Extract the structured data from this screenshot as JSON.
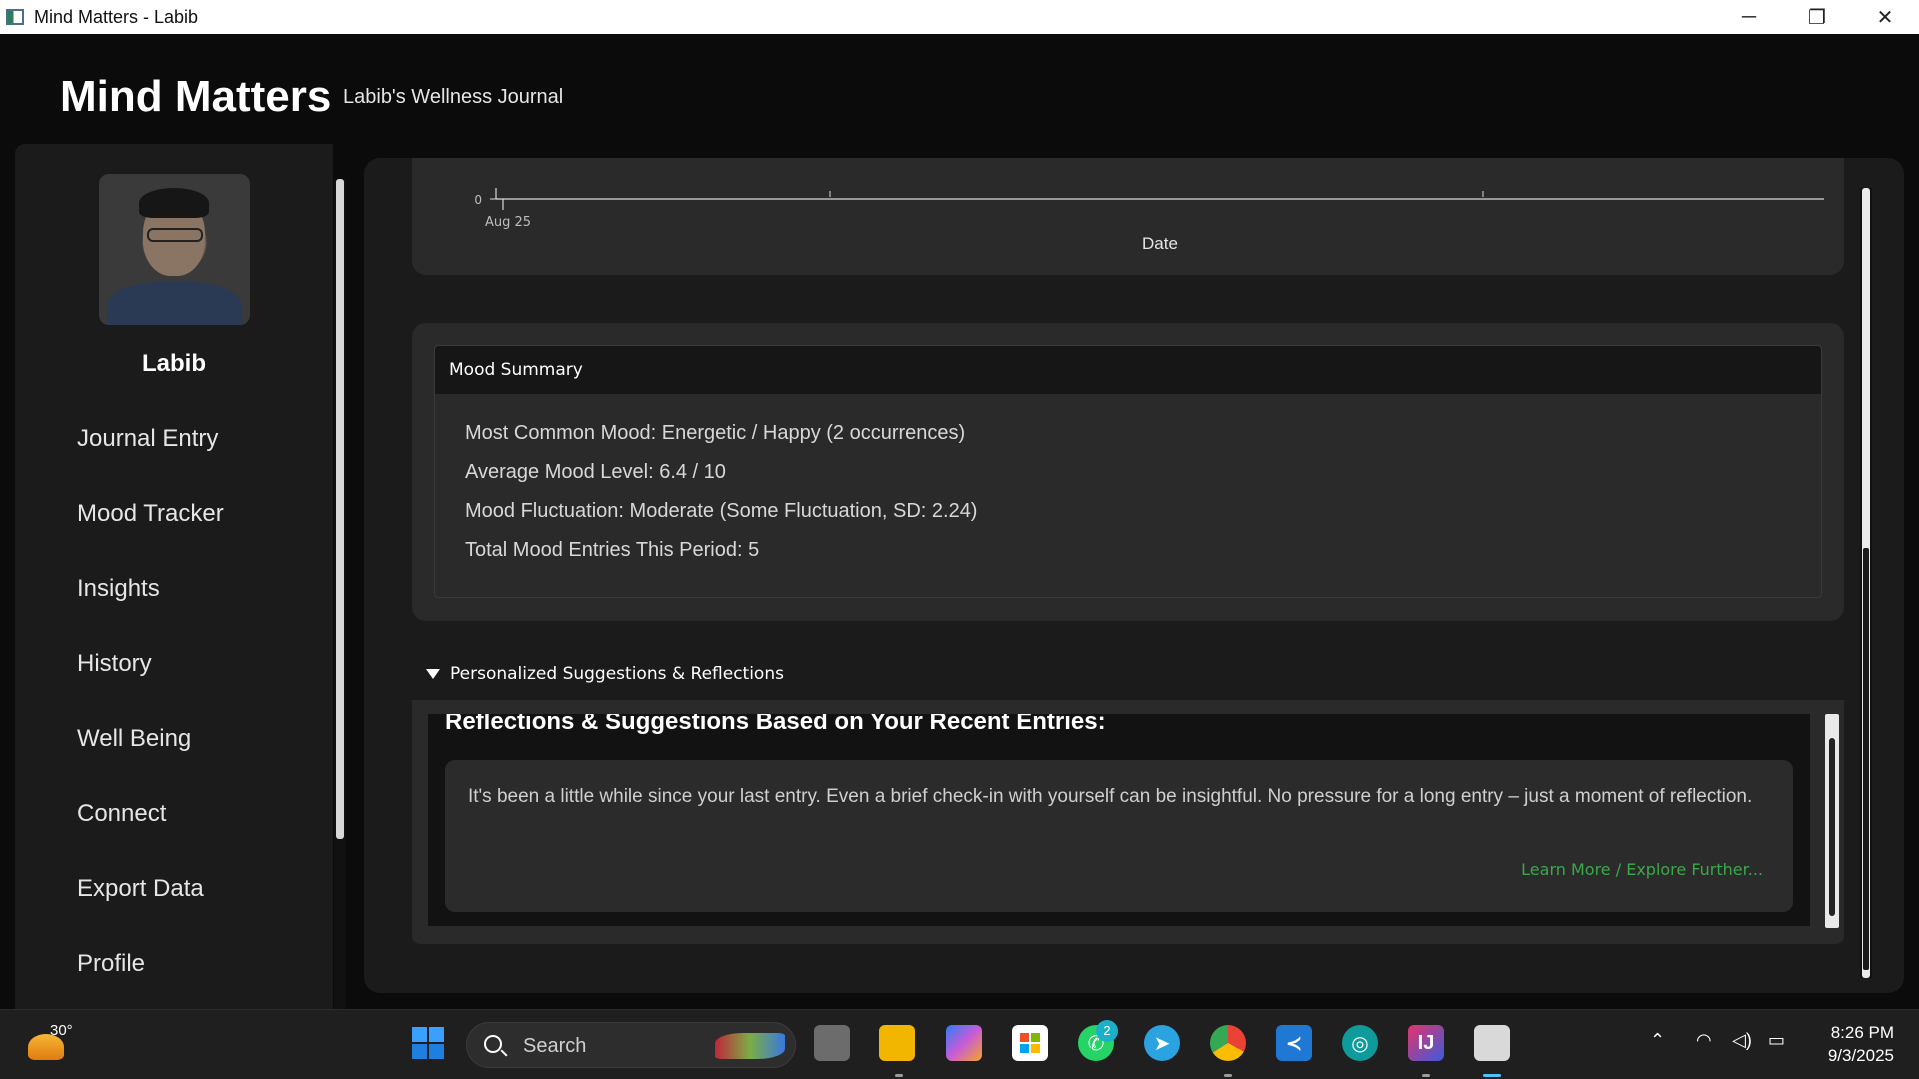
{
  "window": {
    "title": "Mind Matters - Labib",
    "minimize": "─",
    "maximize": "❐",
    "close": "✕"
  },
  "app": {
    "brand": "Mind Matters",
    "subtitle": "Labib's Wellness Journal"
  },
  "sidebar": {
    "user_name": "Labib",
    "items": [
      {
        "label": "Journal Entry"
      },
      {
        "label": "Mood Tracker"
      },
      {
        "label": "Insights"
      },
      {
        "label": "History"
      },
      {
        "label": "Well Being"
      },
      {
        "label": "Connect"
      },
      {
        "label": "Export Data"
      },
      {
        "label": "Profile"
      }
    ]
  },
  "chart_data": {
    "type": "line",
    "xlabel": "Date",
    "ylabel": "",
    "y_visible_tick": "0",
    "x_tick_labels": [
      "Aug 25"
    ],
    "series": []
  },
  "mood_summary": {
    "title": "Mood Summary",
    "lines": [
      "Most Common Mood: Energetic / Happy (2 occurrences)",
      "Average Mood Level: 6.4 / 10",
      "Mood Fluctuation: Moderate (Some Fluctuation, SD: 2.24)",
      "Total Mood Entries This Period: 5"
    ]
  },
  "suggestions": {
    "header": "Personalized Suggestions & Reflections",
    "title": "Reflections & Suggestions Based on Your Recent Entries:",
    "items": [
      {
        "text": "It's been a little while since your last entry. Even a brief check-in with yourself can be insightful. No pressure for a long entry – just a moment of reflection.",
        "link": "Learn More / Explore Further..."
      }
    ]
  },
  "taskbar": {
    "weather_temp": "30°",
    "search_label": "Search",
    "whatsapp_badge": "2",
    "time": "8:26 PM",
    "date": "9/3/2025",
    "accent_colors": {
      "link_green": "#3ba84a",
      "windows_blue": "#1e90ff"
    }
  }
}
